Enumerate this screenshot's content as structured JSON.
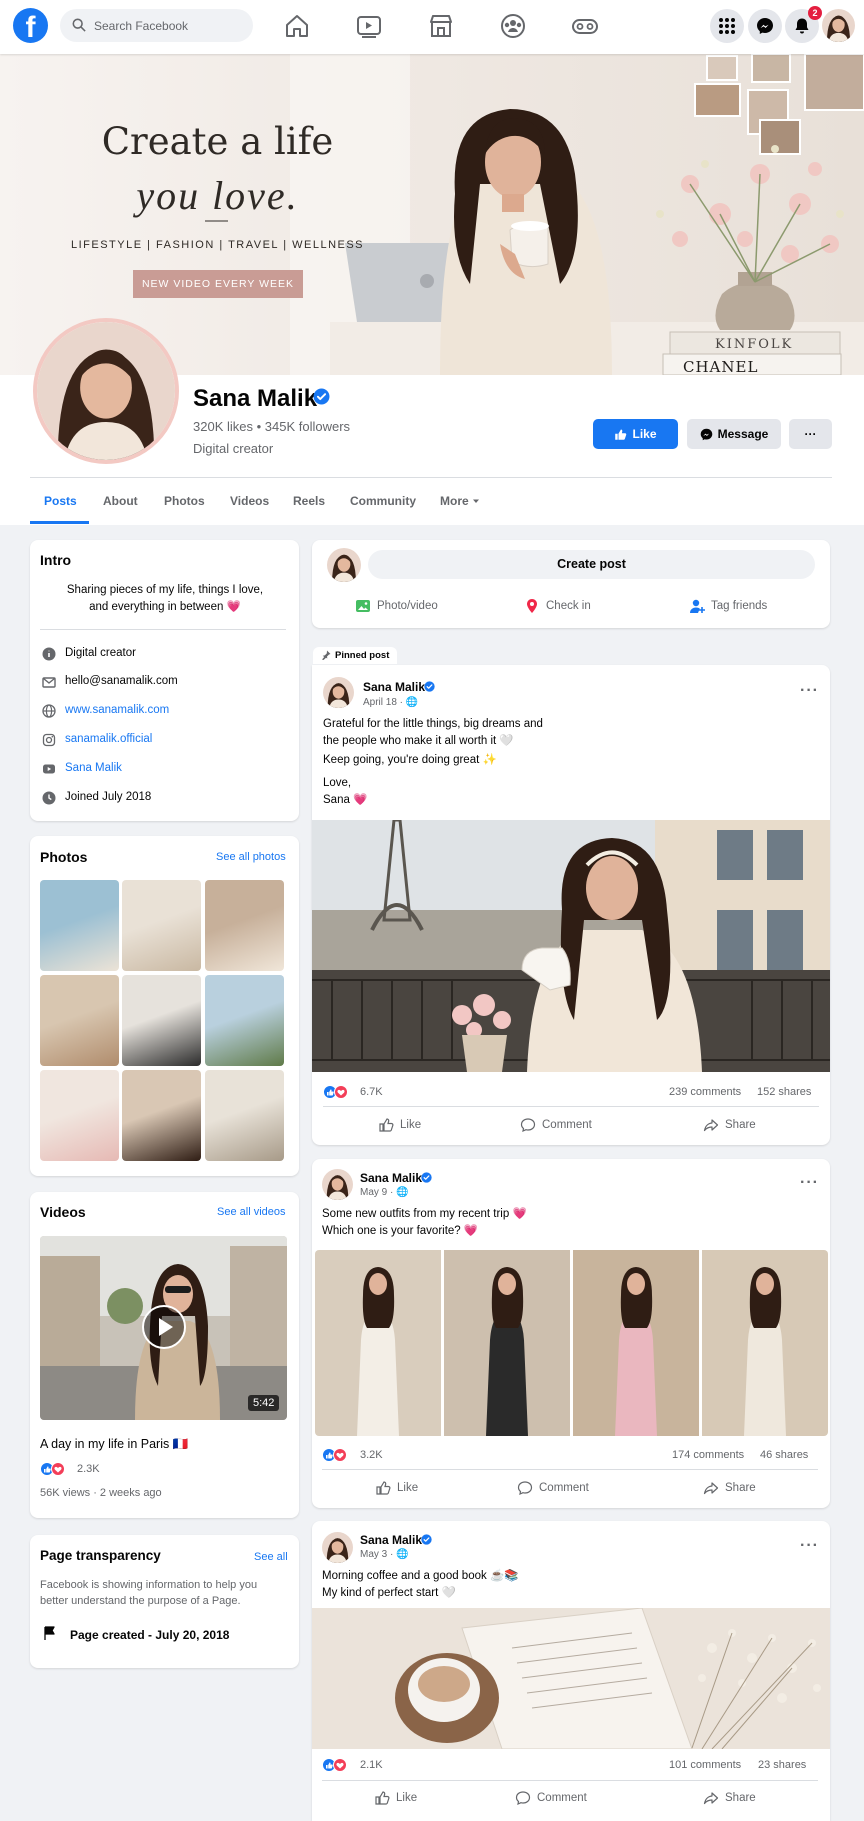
{
  "topbar": {
    "search_placeholder": "Search Facebook",
    "notification_count": "2",
    "icons": [
      "facebook-logo",
      "search-icon",
      "home-icon",
      "video-icon",
      "marketplace-icon",
      "groups-icon",
      "gaming-icon",
      "menu-grid-icon",
      "messenger-icon",
      "bell-icon"
    ]
  },
  "cover": {
    "headline_1": "Create a life",
    "headline_2": "you love.",
    "tagline": "LIFESTYLE | FASHION | TRAVEL | WELLNESS",
    "button": "NEW VIDEO EVERY WEEK",
    "book_1": "KINFOLK",
    "book_2": "CHANEL"
  },
  "profile": {
    "name": "Sana Malik",
    "stats": "320K likes • 345K followers",
    "category": "Digital creator",
    "like_button": "Like",
    "message_button": "Message",
    "more_button": "···"
  },
  "tabs": [
    "Posts",
    "About",
    "Photos",
    "Videos",
    "Reels",
    "Community",
    "More"
  ],
  "intro": {
    "title": "Intro",
    "bio_line_1": "Sharing pieces of my life, things I love,",
    "bio_line_2": "and everything in between 💗",
    "category": "Digital creator",
    "email": "hello@sanamalik.com",
    "website": "www.sanamalik.com",
    "instagram": "sanamalik.official",
    "youtube": "Sana Malik",
    "joined": "Joined July 2018"
  },
  "photos": {
    "title": "Photos",
    "see_all": "See all photos"
  },
  "videos": {
    "title": "Videos",
    "see_all": "See all videos",
    "duration": "5:42",
    "caption": "A day in my life in Paris 🇫🇷",
    "reactions": "2.3K",
    "meta": "56K views · 2 weeks ago"
  },
  "transparency": {
    "title": "Page transparency",
    "see_all": "See all",
    "desc_1": "Facebook is showing information to help you",
    "desc_2": "better understand the purpose of a Page.",
    "created": "Page created - July 20, 2018"
  },
  "composer": {
    "create_post": "Create post",
    "photo_video": "Photo/video",
    "check_in": "Check in",
    "tag_friends": "Tag friends"
  },
  "pinned_label": "Pinned post",
  "posts": [
    {
      "author": "Sana Malik",
      "date": "April 18 · 🌐",
      "lines": [
        "Grateful for the little things, big dreams and",
        "the people who make it all worth it 🤍",
        "Keep going, you're doing great ✨",
        "Love,",
        "Sana 💗"
      ],
      "reactions": "6.7K",
      "comments": "239 comments",
      "shares": "152 shares"
    },
    {
      "author": "Sana Malik",
      "date": "May 9 · 🌐",
      "lines": [
        "Some new outfits from my recent trip 💗",
        "Which one is your favorite? 💗"
      ],
      "reactions": "3.2K",
      "comments": "174 comments",
      "shares": "46 shares"
    },
    {
      "author": "Sana Malik",
      "date": "May 3 · 🌐",
      "lines": [
        "Morning coffee and a good book ☕📚",
        "My kind of perfect start 🤍"
      ],
      "reactions": "2.1K",
      "comments": "101 comments",
      "shares": "23 shares"
    }
  ],
  "actions": {
    "like": "Like",
    "comment": "Comment",
    "share": "Share"
  },
  "colors": {
    "brand": "#1877f2",
    "background": "#f0f2f5",
    "accent_pink": "#c99c95"
  }
}
